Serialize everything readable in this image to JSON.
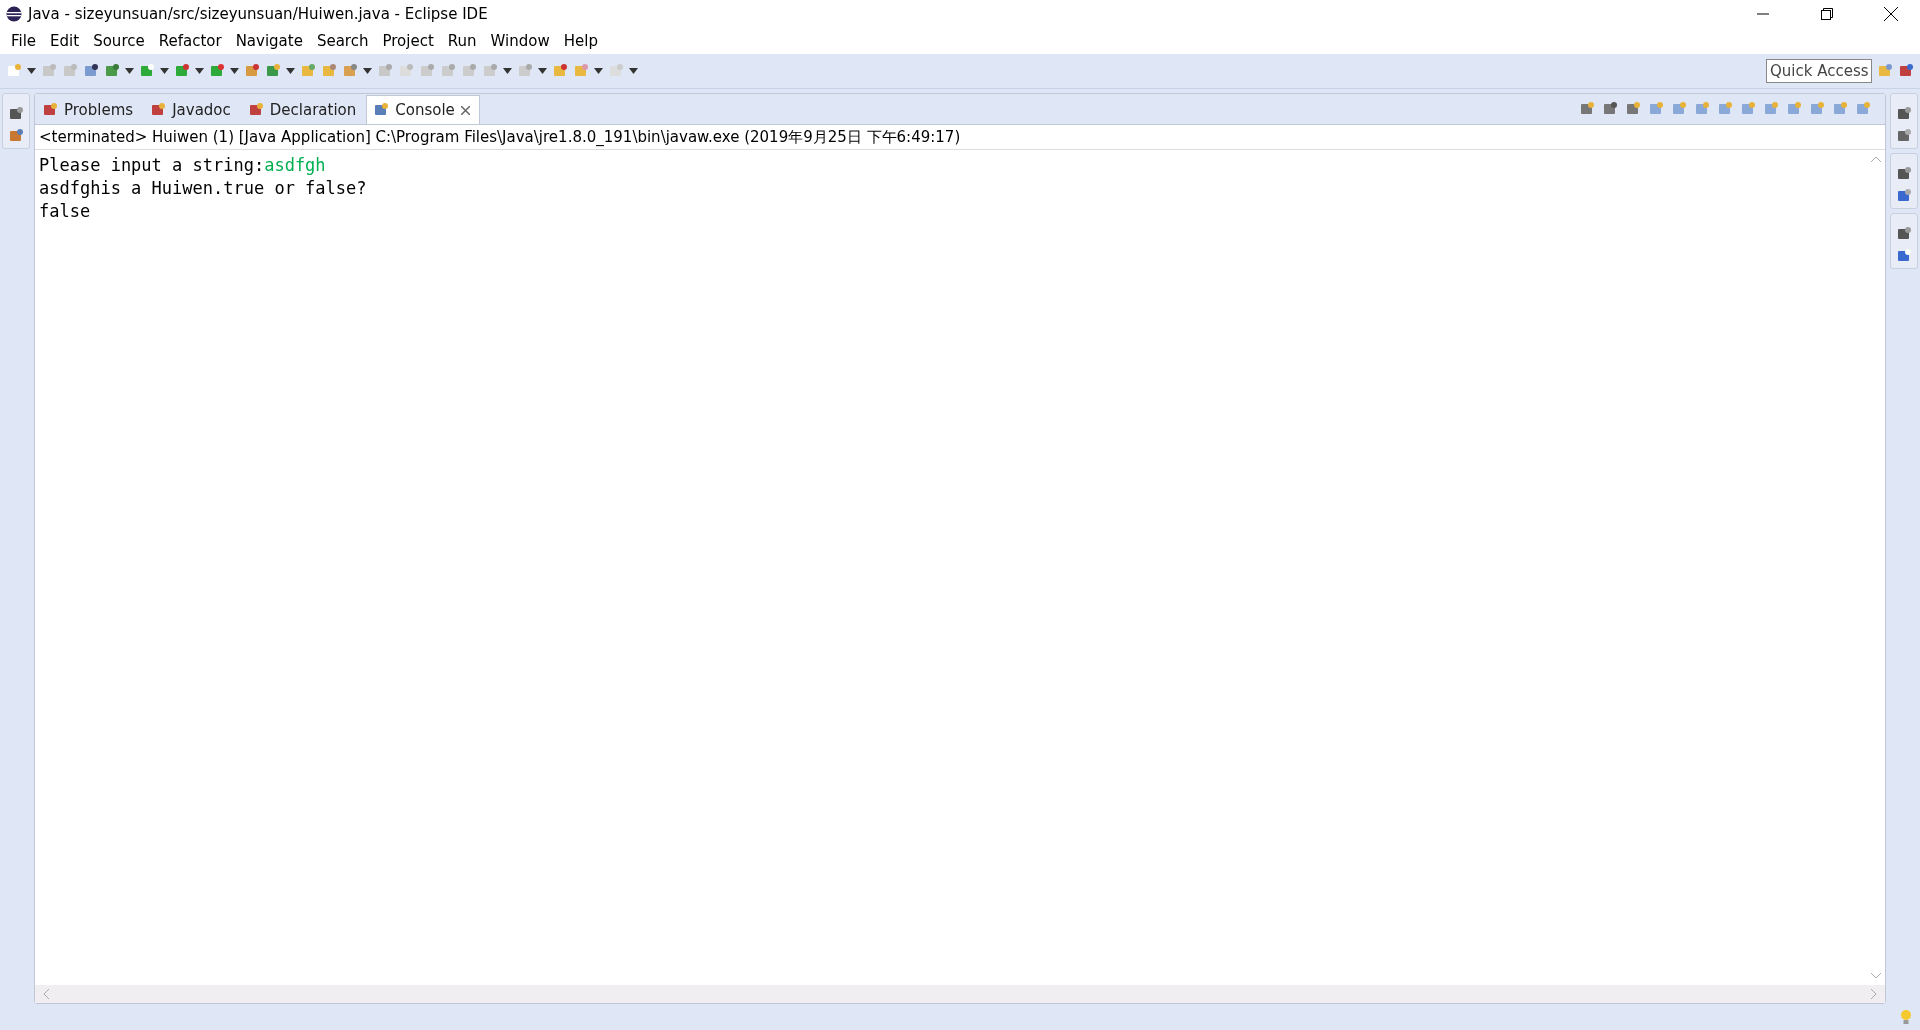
{
  "window": {
    "title": "Java - sizeyunsuan/src/sizeyunsuan/Huiwen.java - Eclipse IDE"
  },
  "menu": [
    {
      "label": "File"
    },
    {
      "label": "Edit"
    },
    {
      "label": "Source"
    },
    {
      "label": "Refactor"
    },
    {
      "label": "Navigate"
    },
    {
      "label": "Search"
    },
    {
      "label": "Project"
    },
    {
      "label": "Run"
    },
    {
      "label": "Window"
    },
    {
      "label": "Help"
    }
  ],
  "quick_access": {
    "placeholder": "Quick Access"
  },
  "tabs": [
    {
      "label": "Problems",
      "selected": false
    },
    {
      "label": "Javadoc",
      "selected": false
    },
    {
      "label": "Declaration",
      "selected": false
    },
    {
      "label": "Console",
      "selected": true
    }
  ],
  "console": {
    "header": "<terminated> Huiwen (1) [Java Application] C:\\Program Files\\Java\\jre1.8.0_191\\bin\\javaw.exe (2019年9月25日 下午6:49:17)",
    "lines": [
      [
        {
          "kind": "output",
          "text": "Please input a string:"
        },
        {
          "kind": "input",
          "text": "asdfgh"
        }
      ],
      [
        {
          "kind": "output",
          "text": "asdfghis a Huiwen.true or false?"
        }
      ],
      [
        {
          "kind": "output",
          "text": "false"
        }
      ]
    ]
  }
}
